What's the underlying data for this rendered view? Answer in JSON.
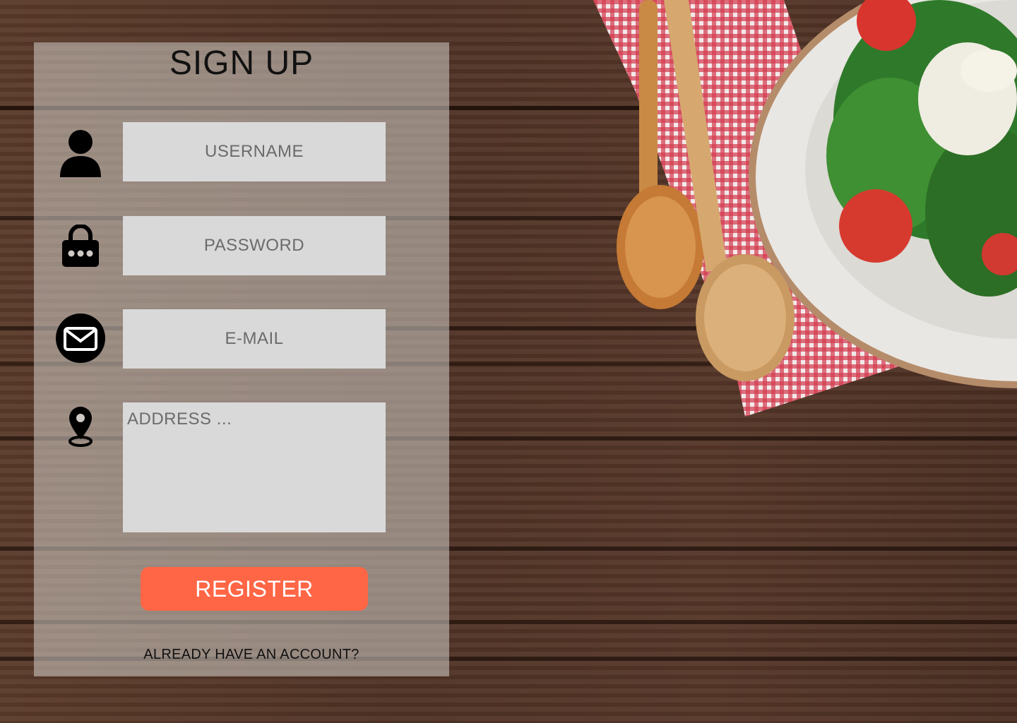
{
  "form": {
    "title": "SIGN UP",
    "username_placeholder": "USERNAME",
    "password_placeholder": "PASSWORD",
    "email_placeholder": "E-MAIL",
    "address_placeholder": "ADDRESS ...",
    "register_label": "REGISTER",
    "login_link": "ALREADY HAVE AN ACCOUNT?"
  },
  "icons": {
    "username": "user-icon",
    "password": "lock-icon",
    "email": "envelope-icon",
    "address": "location-pin-icon"
  },
  "colors": {
    "accent": "#ff6645",
    "field_bg": "#d9d9d9",
    "wood": "#4f3225"
  }
}
